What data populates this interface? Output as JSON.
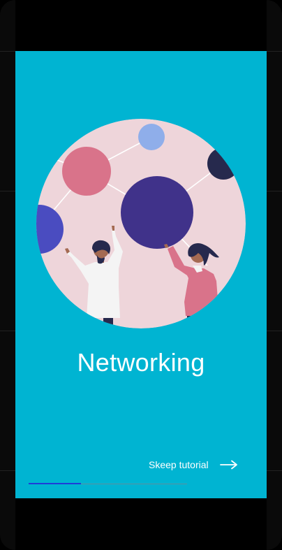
{
  "onboarding": {
    "title": "Networking",
    "skip_label": "Skeep tutorial",
    "arrow_icon": "arrow-right-icon",
    "progress": {
      "current_step": 1,
      "total_steps": 3,
      "fraction": 0.33
    },
    "colors": {
      "background": "#00B4D2",
      "illustration_bg": "#EED5DA",
      "node_pink": "#D9738A",
      "node_lightblue": "#8FAEEA",
      "node_navy": "#26294D",
      "node_purple": "#40328A",
      "node_blue": "#4A4CC0",
      "progress_fill": "#1F3CD8"
    }
  }
}
